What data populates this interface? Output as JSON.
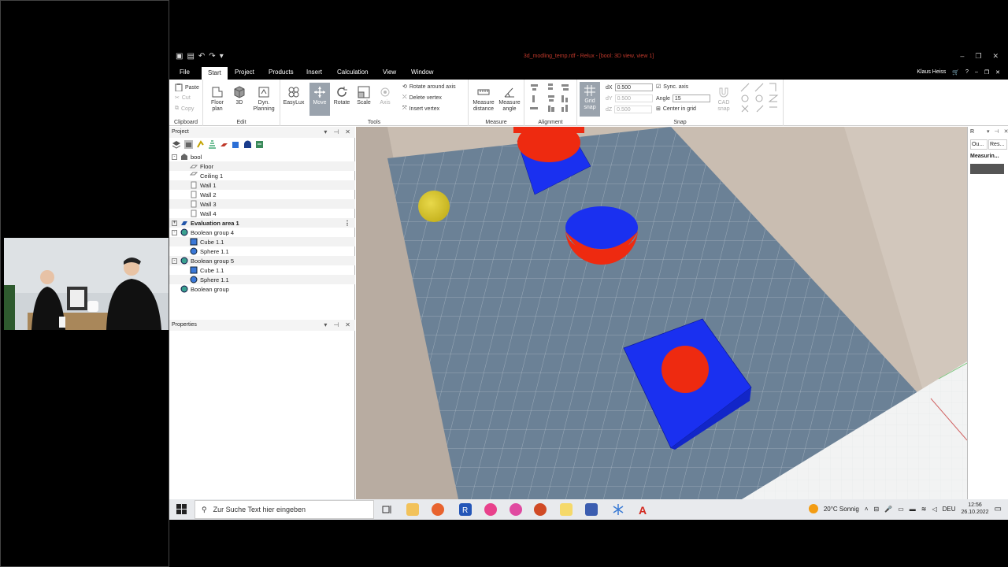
{
  "window": {
    "title": "3d_modling_temp.rdf - Relux - [bool: 3D view, view 1]",
    "user": "Klaus Heiss"
  },
  "menu": {
    "tabs": [
      "File",
      "Start",
      "Project",
      "Products",
      "Insert",
      "Calculation",
      "View",
      "Window"
    ],
    "active": "Start"
  },
  "ribbon": {
    "clipboard": {
      "label": "Clipboard",
      "paste": "Paste",
      "cut": "Cut",
      "copy": "Copy"
    },
    "edit": {
      "label": "Edit",
      "floor_plan": "Floor plan",
      "three_d": "3D",
      "dyn_planning": "Dyn. Planning"
    },
    "tools": {
      "label": "Tools",
      "easylux": "EasyLux",
      "move": "Move",
      "rotate": "Rotate",
      "scale": "Scale",
      "axis": "Axis",
      "rotate_around_axis": "Rotate around axis",
      "delete_vertex": "Delete vertex",
      "insert_vertex": "Insert vertex"
    },
    "measure": {
      "label": "Measure",
      "distance": "Measure distance",
      "angle": "Measure angle"
    },
    "alignment": {
      "label": "Alignment"
    },
    "snap": {
      "label": "Snap",
      "grid_snap": "Grid snap",
      "dx_label": "dX",
      "dx_value": "0.500",
      "dy_label": "dY",
      "dy_value": "0.500",
      "dz_label": "dZ",
      "dz_value": "0.500",
      "sync_axis": "Sync. axis",
      "angle_label": "Angle",
      "angle_value": "15",
      "center_in_grid": "Center in grid",
      "cad_snap": "CAD snap"
    }
  },
  "project_panel": {
    "title": "Project",
    "tree": [
      {
        "label": "bool",
        "level": 0,
        "icon": "building-icon",
        "exp": "-"
      },
      {
        "label": "Floor",
        "level": 1,
        "icon": "floor-icon"
      },
      {
        "label": "Ceiling 1",
        "level": 1,
        "icon": "ceiling-icon"
      },
      {
        "label": "Wall 1",
        "level": 1,
        "icon": "wall-icon"
      },
      {
        "label": "Wall 2",
        "level": 1,
        "icon": "wall-icon"
      },
      {
        "label": "Wall 3",
        "level": 1,
        "icon": "wall-icon"
      },
      {
        "label": "Wall 4",
        "level": 1,
        "icon": "wall-icon"
      },
      {
        "label": "Evaluation area 1",
        "level": 0,
        "icon": "evaluation-area-icon",
        "exp": "+",
        "bold": true
      },
      {
        "label": "Boolean group 4",
        "level": 0,
        "icon": "boolean-group-icon",
        "exp": "-"
      },
      {
        "label": "Cube 1.1",
        "level": 1,
        "icon": "cube-icon"
      },
      {
        "label": "Sphere 1.1",
        "level": 1,
        "icon": "sphere-icon"
      },
      {
        "label": "Boolean group 5",
        "level": 0,
        "icon": "boolean-group-icon",
        "exp": "-"
      },
      {
        "label": "Cube 1.1",
        "level": 1,
        "icon": "cube-icon"
      },
      {
        "label": "Sphere 1.1",
        "level": 1,
        "icon": "sphere-icon"
      },
      {
        "label": "Boolean group",
        "level": 0,
        "icon": "boolean-group-icon"
      }
    ]
  },
  "properties_panel": {
    "title": "Properties"
  },
  "right_panel": {
    "tab1": "Ou...",
    "tab2": "Res...",
    "item": "Measurin...",
    "head": "R"
  },
  "taskbar": {
    "search_placeholder": "Zur Suche Text hier eingeben",
    "weather": "20°C  Sonnig",
    "lang": "DEU",
    "time": "12:56",
    "date": "26.10.2022"
  },
  "colors": {
    "floor": "#6b8196",
    "wall": "#cbbfb3",
    "blue_obj": "#1a30f0",
    "red_obj": "#ee2a10",
    "yellow_obj": "#d9c62a"
  }
}
